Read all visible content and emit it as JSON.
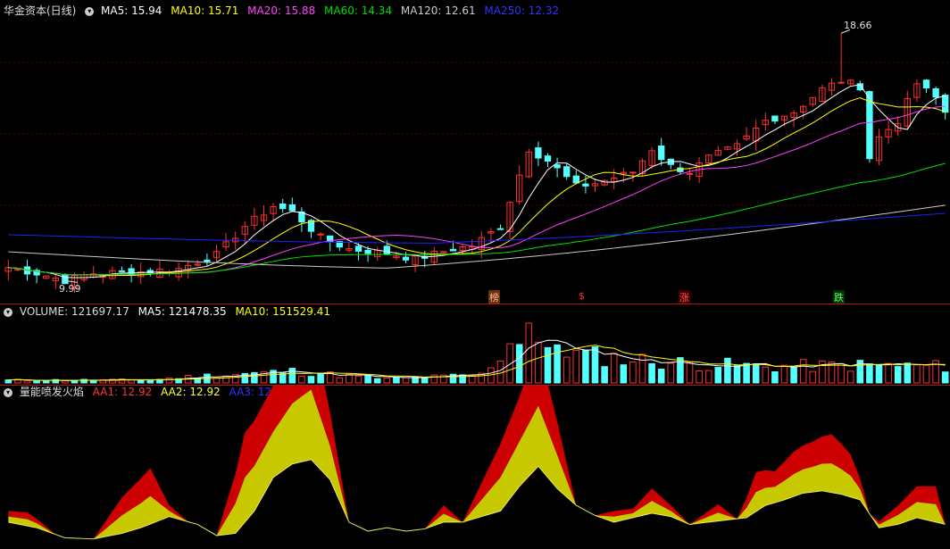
{
  "colors": {
    "up": "#ff3030",
    "down": "#54ffff",
    "ma5": "#ffffff",
    "ma10": "#ffff00",
    "ma20": "#ff40ff",
    "ma60": "#00e000",
    "ma120": "#cccccc",
    "ma250": "#2020ff"
  },
  "price_legend": {
    "title": "华金资本(日线)",
    "ma5": "MA5: 15.94",
    "ma10": "MA10: 15.71",
    "ma20": "MA20: 15.88",
    "ma60": "MA60: 14.34",
    "ma120": "MA120: 12.61",
    "ma250": "MA250: 12.32"
  },
  "high_label": "18.66",
  "low_label": "9.99",
  "markers": {
    "a": "榜",
    "b": "$",
    "c": "涨",
    "d": "跌"
  },
  "volume_legend": {
    "title": "VOLUME: 121697.17",
    "ma5": "MA5: 121478.35",
    "ma10": "MA10: 151529.41"
  },
  "indicator_legend": {
    "title": "量能喷发火焰",
    "aa1": "AA1: 12.92",
    "aa2": "AA2: 12.92",
    "aa3": "AA3: 12.92"
  },
  "chart_data": [
    {
      "type": "candlestick",
      "panel": "price",
      "ylim": [
        9.5,
        19.2
      ],
      "n_bars": 100,
      "anchors_close": [
        [
          0,
          10.45
        ],
        [
          3,
          10.25
        ],
        [
          6,
          9.99
        ],
        [
          9,
          10.25
        ],
        [
          14,
          10.3
        ],
        [
          18,
          10.4
        ],
        [
          22,
          10.9
        ],
        [
          25,
          11.9
        ],
        [
          28,
          12.6
        ],
        [
          30,
          12.4
        ],
        [
          33,
          11.5
        ],
        [
          36,
          11.1
        ],
        [
          40,
          10.95
        ],
        [
          43,
          10.75
        ],
        [
          47,
          11.1
        ],
        [
          49,
          11.2
        ],
        [
          52,
          11.9
        ],
        [
          55,
          14.6
        ],
        [
          57,
          14.2
        ],
        [
          60,
          13.3
        ],
        [
          62,
          13.4
        ],
        [
          64,
          13.6
        ],
        [
          66,
          13.8
        ],
        [
          68,
          14.6
        ],
        [
          70,
          14.0
        ],
        [
          72,
          13.8
        ],
        [
          74,
          14.3
        ],
        [
          77,
          14.7
        ],
        [
          80,
          15.6
        ],
        [
          83,
          15.9
        ],
        [
          86,
          16.7
        ],
        [
          88,
          17.0
        ],
        [
          90,
          16.8
        ],
        [
          91,
          14.3
        ],
        [
          92,
          15.0
        ],
        [
          94,
          15.6
        ],
        [
          96,
          16.9
        ],
        [
          98,
          16.4
        ],
        [
          99,
          15.9
        ]
      ],
      "high": 18.66,
      "low": 9.99
    },
    {
      "type": "volume-bars",
      "panel": "volume",
      "ylim": [
        0,
        460000
      ],
      "values_anchor": [
        [
          0,
          20000
        ],
        [
          15,
          22000
        ],
        [
          20,
          50000
        ],
        [
          30,
          85000
        ],
        [
          40,
          30000
        ],
        [
          50,
          60000
        ],
        [
          55,
          440000
        ],
        [
          60,
          210000
        ],
        [
          70,
          150000
        ],
        [
          80,
          120000
        ],
        [
          90,
          130000
        ],
        [
          99,
          121697
        ]
      ]
    },
    {
      "type": "area",
      "panel": "indicator",
      "ylim": [
        0,
        100
      ],
      "series": [
        {
          "name": "AA1"
        },
        {
          "name": "AA2"
        },
        {
          "name": "AA3"
        }
      ]
    }
  ]
}
